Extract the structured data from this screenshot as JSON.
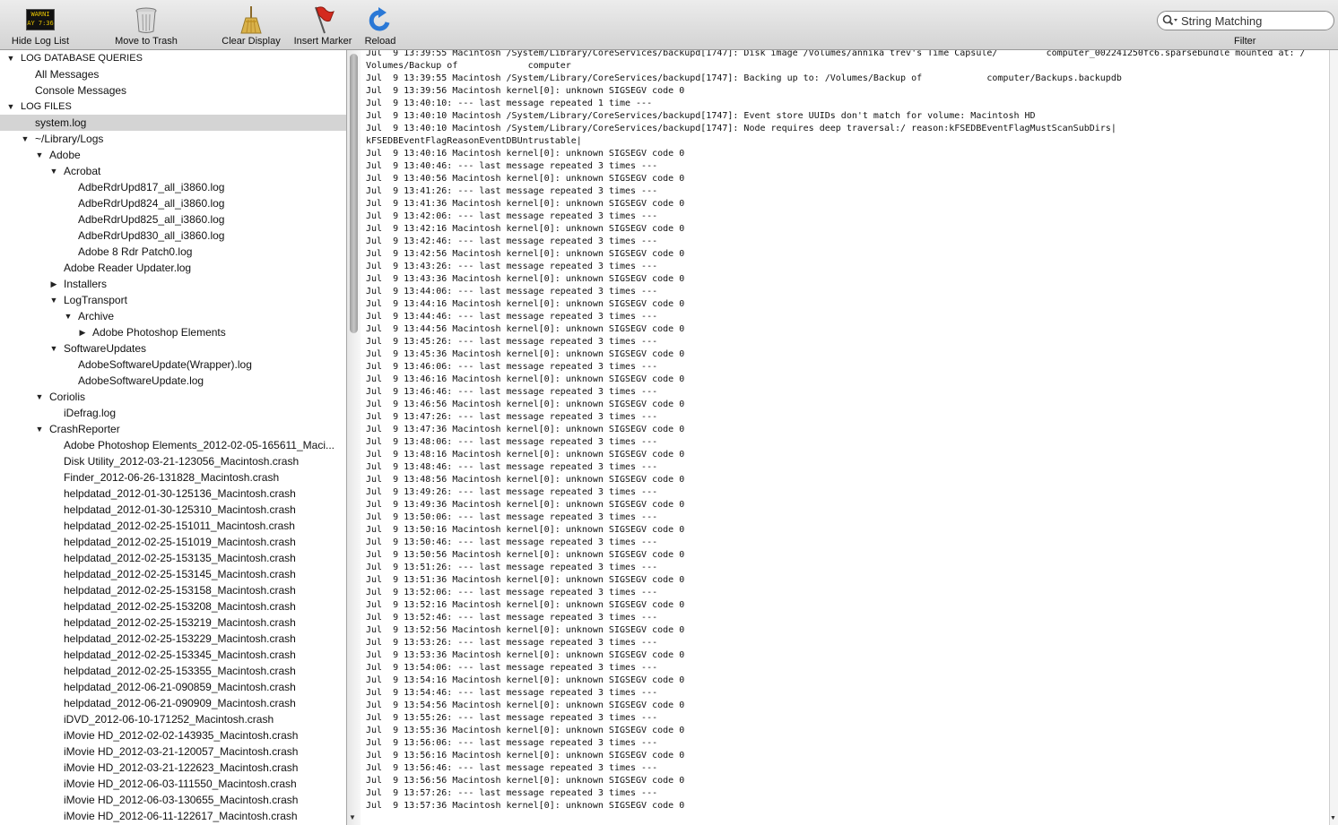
{
  "toolbar": {
    "buttons": [
      {
        "label": "Hide Log List",
        "icon": "warning-console-icon",
        "warn_text": "WARNI\nAY 7:36"
      },
      {
        "label": "Move to Trash",
        "icon": "trash-icon"
      },
      {
        "label": "Clear Display",
        "icon": "broom-icon"
      },
      {
        "label": "Insert Marker",
        "icon": "flag-icon"
      },
      {
        "label": "Reload",
        "icon": "reload-icon"
      }
    ],
    "search_value": "String Matching",
    "filter_label": "Filter"
  },
  "sidebar": {
    "items": [
      {
        "label": "LOG DATABASE QUERIES",
        "level": 0,
        "toggle": "open",
        "header": true
      },
      {
        "label": "All Messages",
        "level": 1,
        "toggle": "none"
      },
      {
        "label": "Console Messages",
        "level": 1,
        "toggle": "none"
      },
      {
        "label": "LOG FILES",
        "level": 0,
        "toggle": "open",
        "header": true
      },
      {
        "label": "system.log",
        "level": 1,
        "toggle": "none",
        "selected": true
      },
      {
        "label": "~/Library/Logs",
        "level": 1,
        "toggle": "open"
      },
      {
        "label": "Adobe",
        "level": 2,
        "toggle": "open"
      },
      {
        "label": "Acrobat",
        "level": 3,
        "toggle": "open"
      },
      {
        "label": "AdbeRdrUpd817_all_i3860.log",
        "level": 4,
        "toggle": "none"
      },
      {
        "label": "AdbeRdrUpd824_all_i3860.log",
        "level": 4,
        "toggle": "none"
      },
      {
        "label": "AdbeRdrUpd825_all_i3860.log",
        "level": 4,
        "toggle": "none"
      },
      {
        "label": "AdbeRdrUpd830_all_i3860.log",
        "level": 4,
        "toggle": "none"
      },
      {
        "label": "Adobe 8 Rdr Patch0.log",
        "level": 4,
        "toggle": "none"
      },
      {
        "label": "Adobe Reader Updater.log",
        "level": 3,
        "toggle": "none"
      },
      {
        "label": "Installers",
        "level": 3,
        "toggle": "closed"
      },
      {
        "label": "LogTransport",
        "level": 3,
        "toggle": "open"
      },
      {
        "label": "Archive",
        "level": 4,
        "toggle": "open"
      },
      {
        "label": "Adobe Photoshop Elements",
        "level": 5,
        "toggle": "closed"
      },
      {
        "label": "SoftwareUpdates",
        "level": 3,
        "toggle": "open"
      },
      {
        "label": "AdobeSoftwareUpdate(Wrapper).log",
        "level": 4,
        "toggle": "none"
      },
      {
        "label": "AdobeSoftwareUpdate.log",
        "level": 4,
        "toggle": "none"
      },
      {
        "label": "Coriolis",
        "level": 2,
        "toggle": "open"
      },
      {
        "label": "iDefrag.log",
        "level": 3,
        "toggle": "none"
      },
      {
        "label": "CrashReporter",
        "level": 2,
        "toggle": "open"
      },
      {
        "label": "Adobe Photoshop Elements_2012-02-05-165611_Maci...",
        "level": 3,
        "toggle": "none"
      },
      {
        "label": "Disk Utility_2012-03-21-123056_Macintosh.crash",
        "level": 3,
        "toggle": "none"
      },
      {
        "label": "Finder_2012-06-26-131828_Macintosh.crash",
        "level": 3,
        "toggle": "none"
      },
      {
        "label": "helpdatad_2012-01-30-125136_Macintosh.crash",
        "level": 3,
        "toggle": "none"
      },
      {
        "label": "helpdatad_2012-01-30-125310_Macintosh.crash",
        "level": 3,
        "toggle": "none"
      },
      {
        "label": "helpdatad_2012-02-25-151011_Macintosh.crash",
        "level": 3,
        "toggle": "none"
      },
      {
        "label": "helpdatad_2012-02-25-151019_Macintosh.crash",
        "level": 3,
        "toggle": "none"
      },
      {
        "label": "helpdatad_2012-02-25-153135_Macintosh.crash",
        "level": 3,
        "toggle": "none"
      },
      {
        "label": "helpdatad_2012-02-25-153145_Macintosh.crash",
        "level": 3,
        "toggle": "none"
      },
      {
        "label": "helpdatad_2012-02-25-153158_Macintosh.crash",
        "level": 3,
        "toggle": "none"
      },
      {
        "label": "helpdatad_2012-02-25-153208_Macintosh.crash",
        "level": 3,
        "toggle": "none"
      },
      {
        "label": "helpdatad_2012-02-25-153219_Macintosh.crash",
        "level": 3,
        "toggle": "none"
      },
      {
        "label": "helpdatad_2012-02-25-153229_Macintosh.crash",
        "level": 3,
        "toggle": "none"
      },
      {
        "label": "helpdatad_2012-02-25-153345_Macintosh.crash",
        "level": 3,
        "toggle": "none"
      },
      {
        "label": "helpdatad_2012-02-25-153355_Macintosh.crash",
        "level": 3,
        "toggle": "none"
      },
      {
        "label": "helpdatad_2012-06-21-090859_Macintosh.crash",
        "level": 3,
        "toggle": "none"
      },
      {
        "label": "helpdatad_2012-06-21-090909_Macintosh.crash",
        "level": 3,
        "toggle": "none"
      },
      {
        "label": "iDVD_2012-06-10-171252_Macintosh.crash",
        "level": 3,
        "toggle": "none"
      },
      {
        "label": "iMovie HD_2012-02-02-143935_Macintosh.crash",
        "level": 3,
        "toggle": "none"
      },
      {
        "label": "iMovie HD_2012-03-21-120057_Macintosh.crash",
        "level": 3,
        "toggle": "none"
      },
      {
        "label": "iMovie HD_2012-03-21-122623_Macintosh.crash",
        "level": 3,
        "toggle": "none"
      },
      {
        "label": "iMovie HD_2012-06-03-111550_Macintosh.crash",
        "level": 3,
        "toggle": "none"
      },
      {
        "label": "iMovie HD_2012-06-03-130655_Macintosh.crash",
        "level": 3,
        "toggle": "none"
      },
      {
        "label": "iMovie HD_2012-06-11-122617_Macintosh.crash",
        "level": 3,
        "toggle": "none"
      }
    ]
  },
  "log": {
    "lines": [
      "Jul  9 13:39:55 Macintosh /System/Library/CoreServices/backupd[1747]: Disk image /Volumes/annika trev's Time Capsule/         computer_002241250fc6.sparsebundle mounted at: /",
      "Volumes/Backup of             computer",
      "Jul  9 13:39:55 Macintosh /System/Library/CoreServices/backupd[1747]: Backing up to: /Volumes/Backup of            computer/Backups.backupdb",
      "Jul  9 13:39:56 Macintosh kernel[0]: unknown SIGSEGV code 0",
      "Jul  9 13:40:10: --- last message repeated 1 time ---",
      "Jul  9 13:40:10 Macintosh /System/Library/CoreServices/backupd[1747]: Event store UUIDs don't match for volume: Macintosh HD",
      "Jul  9 13:40:10 Macintosh /System/Library/CoreServices/backupd[1747]: Node requires deep traversal:/ reason:kFSEDBEventFlagMustScanSubDirs|",
      "kFSEDBEventFlagReasonEventDBUntrustable|",
      "Jul  9 13:40:16 Macintosh kernel[0]: unknown SIGSEGV code 0",
      "Jul  9 13:40:46: --- last message repeated 3 times ---",
      "Jul  9 13:40:56 Macintosh kernel[0]: unknown SIGSEGV code 0",
      "Jul  9 13:41:26: --- last message repeated 3 times ---",
      "Jul  9 13:41:36 Macintosh kernel[0]: unknown SIGSEGV code 0",
      "Jul  9 13:42:06: --- last message repeated 3 times ---",
      "Jul  9 13:42:16 Macintosh kernel[0]: unknown SIGSEGV code 0",
      "Jul  9 13:42:46: --- last message repeated 3 times ---",
      "Jul  9 13:42:56 Macintosh kernel[0]: unknown SIGSEGV code 0",
      "Jul  9 13:43:26: --- last message repeated 3 times ---",
      "Jul  9 13:43:36 Macintosh kernel[0]: unknown SIGSEGV code 0",
      "Jul  9 13:44:06: --- last message repeated 3 times ---",
      "Jul  9 13:44:16 Macintosh kernel[0]: unknown SIGSEGV code 0",
      "Jul  9 13:44:46: --- last message repeated 3 times ---",
      "Jul  9 13:44:56 Macintosh kernel[0]: unknown SIGSEGV code 0",
      "Jul  9 13:45:26: --- last message repeated 3 times ---",
      "Jul  9 13:45:36 Macintosh kernel[0]: unknown SIGSEGV code 0",
      "Jul  9 13:46:06: --- last message repeated 3 times ---",
      "Jul  9 13:46:16 Macintosh kernel[0]: unknown SIGSEGV code 0",
      "Jul  9 13:46:46: --- last message repeated 3 times ---",
      "Jul  9 13:46:56 Macintosh kernel[0]: unknown SIGSEGV code 0",
      "Jul  9 13:47:26: --- last message repeated 3 times ---",
      "Jul  9 13:47:36 Macintosh kernel[0]: unknown SIGSEGV code 0",
      "Jul  9 13:48:06: --- last message repeated 3 times ---",
      "Jul  9 13:48:16 Macintosh kernel[0]: unknown SIGSEGV code 0",
      "Jul  9 13:48:46: --- last message repeated 3 times ---",
      "Jul  9 13:48:56 Macintosh kernel[0]: unknown SIGSEGV code 0",
      "Jul  9 13:49:26: --- last message repeated 3 times ---",
      "Jul  9 13:49:36 Macintosh kernel[0]: unknown SIGSEGV code 0",
      "Jul  9 13:50:06: --- last message repeated 3 times ---",
      "Jul  9 13:50:16 Macintosh kernel[0]: unknown SIGSEGV code 0",
      "Jul  9 13:50:46: --- last message repeated 3 times ---",
      "Jul  9 13:50:56 Macintosh kernel[0]: unknown SIGSEGV code 0",
      "Jul  9 13:51:26: --- last message repeated 3 times ---",
      "Jul  9 13:51:36 Macintosh kernel[0]: unknown SIGSEGV code 0",
      "Jul  9 13:52:06: --- last message repeated 3 times ---",
      "Jul  9 13:52:16 Macintosh kernel[0]: unknown SIGSEGV code 0",
      "Jul  9 13:52:46: --- last message repeated 3 times ---",
      "Jul  9 13:52:56 Macintosh kernel[0]: unknown SIGSEGV code 0",
      "Jul  9 13:53:26: --- last message repeated 3 times ---",
      "Jul  9 13:53:36 Macintosh kernel[0]: unknown SIGSEGV code 0",
      "Jul  9 13:54:06: --- last message repeated 3 times ---",
      "Jul  9 13:54:16 Macintosh kernel[0]: unknown SIGSEGV code 0",
      "Jul  9 13:54:46: --- last message repeated 3 times ---",
      "Jul  9 13:54:56 Macintosh kernel[0]: unknown SIGSEGV code 0",
      "Jul  9 13:55:26: --- last message repeated 3 times ---",
      "Jul  9 13:55:36 Macintosh kernel[0]: unknown SIGSEGV code 0",
      "Jul  9 13:56:06: --- last message repeated 3 times ---",
      "Jul  9 13:56:16 Macintosh kernel[0]: unknown SIGSEGV code 0",
      "Jul  9 13:56:46: --- last message repeated 3 times ---",
      "Jul  9 13:56:56 Macintosh kernel[0]: unknown SIGSEGV code 0",
      "Jul  9 13:57:26: --- last message repeated 3 times ---",
      "Jul  9 13:57:36 Macintosh kernel[0]: unknown SIGSEGV code 0"
    ]
  },
  "colors": {
    "selection": "#d4d4d4",
    "reload_blue": "#2a78d6",
    "flag_red": "#d42a1e"
  }
}
